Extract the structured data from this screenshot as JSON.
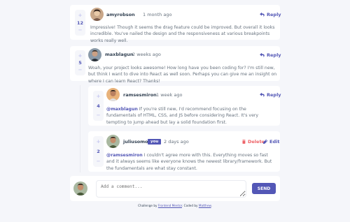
{
  "colors": {
    "background": "#f5f6fa",
    "card": "#ffffff",
    "accent": "#5357b6",
    "danger": "#ed6368",
    "username": "#334253",
    "text": "#67727e",
    "vote_bg": "#f5f6fa",
    "vote_op": "#c5c6ef"
  },
  "comments": [
    {
      "score": "12",
      "username": "amyrobson",
      "date": "1 month ago",
      "reply_label": "Reply",
      "text": "Impressive! Though it seems the drag feature could be improved. But overall it looks incredible. You've nailed the design and the responsiveness at various breakpoints works really well."
    },
    {
      "score": "5",
      "username": "maxblagun",
      "date": "2 weeks ago",
      "reply_label": "Reply",
      "text": "Woah, your project looks awesome! How long have you been coding for? I'm still new, but think I want to dive into React as well soon. Perhaps you can give me an insight on where I can learn React? Thanks!"
    }
  ],
  "replies": [
    {
      "score": "4",
      "username": "ramsesmiron",
      "date": "1 week ago",
      "reply_label": "Reply",
      "mention": "@maxblagun",
      "text": " If you're still new, I'd recommend focusing on the fundamentals of HTML, CSS, and JS before considering React. It's very tempting to jump ahead but lay a solid foundation first."
    },
    {
      "score": "2",
      "username": "juliusomo",
      "badge": "you",
      "date": "2 days ago",
      "delete_label": "Delete",
      "edit_label": "Edit",
      "mention": "@ramsesmiron",
      "text": " I couldn't agree more with this. Everything moves so fast and it always seems like everyone knows the newest library/framework. But the fundamentals are what stay constant."
    }
  ],
  "vote": {
    "plus": "+",
    "minus": "−"
  },
  "composer": {
    "placeholder": "Add a comment...",
    "send_label": "SEND"
  },
  "attribution": {
    "prefix": "Challenge by ",
    "link1": "Frontend Mentor",
    "middle": ". Coded by ",
    "link2": "Matthew",
    "suffix": "."
  },
  "icons": {
    "reply": "reply-icon",
    "delete": "trash-icon",
    "edit": "pencil-icon"
  }
}
